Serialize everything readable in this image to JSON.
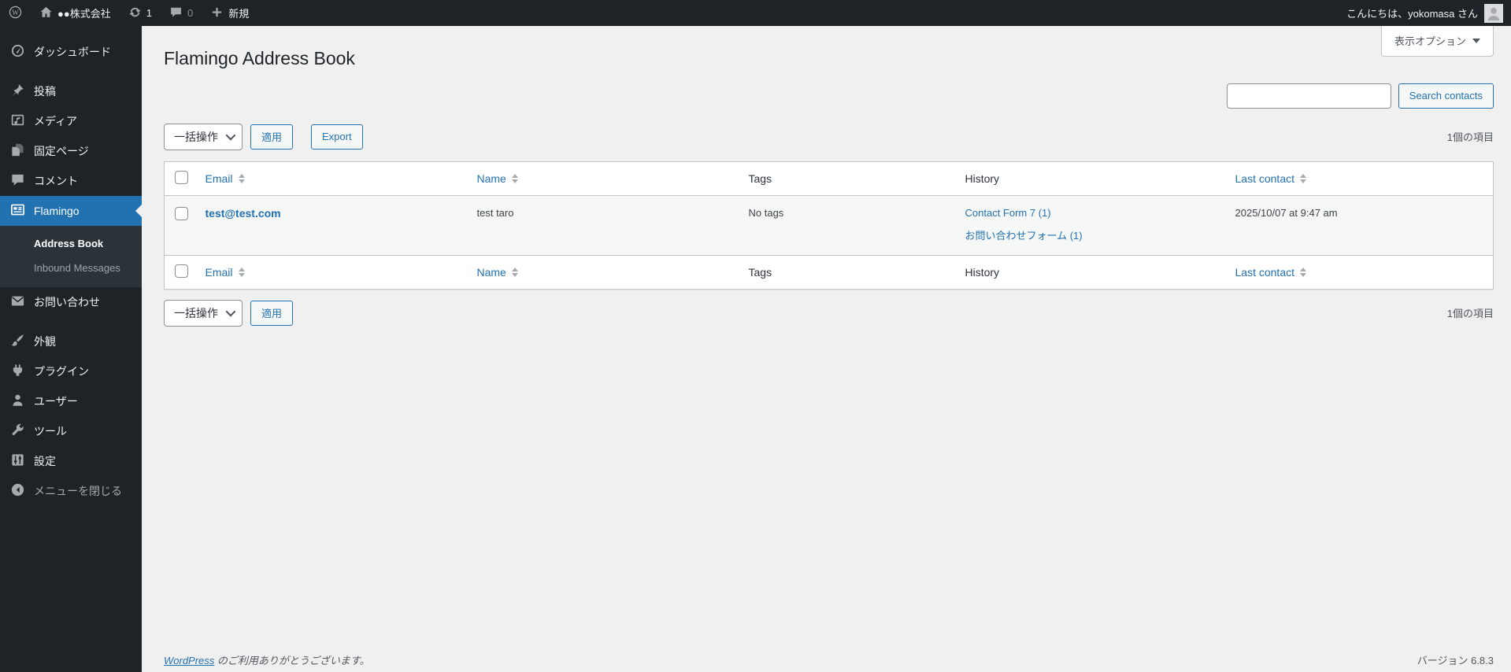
{
  "admin_bar": {
    "site_name": "●●株式会社",
    "update_count": "1",
    "comment_count": "0",
    "new_label": "新規",
    "greeting": "こんにちは、yokomasa さん"
  },
  "sidebar": {
    "items": [
      {
        "label": "ダッシュボード",
        "icon": "gauge-icon"
      },
      {
        "label": "投稿",
        "icon": "pushpin-icon"
      },
      {
        "label": "メディア",
        "icon": "media-icon"
      },
      {
        "label": "固定ページ",
        "icon": "pages-icon"
      },
      {
        "label": "コメント",
        "icon": "comment-icon"
      },
      {
        "label": "Flamingo",
        "icon": "address-card-icon",
        "active": true
      },
      {
        "label": "お問い合わせ",
        "icon": "envelope-icon"
      },
      {
        "label": "外観",
        "icon": "brush-icon"
      },
      {
        "label": "プラグイン",
        "icon": "plug-icon"
      },
      {
        "label": "ユーザー",
        "icon": "user-icon"
      },
      {
        "label": "ツール",
        "icon": "wrench-icon"
      },
      {
        "label": "設定",
        "icon": "sliders-icon"
      }
    ],
    "flamingo_submenu": [
      {
        "label": "Address Book",
        "active": true
      },
      {
        "label": "Inbound Messages",
        "active": false
      }
    ],
    "collapse_label": "メニューを閉じる"
  },
  "page": {
    "title": "Flamingo Address Book",
    "screen_options_label": "表示オプション",
    "search_value": "",
    "search_button": "Search contacts",
    "bulk_action_label": "一括操作",
    "apply_button": "適用",
    "export_button": "Export",
    "item_count": "1個の項目"
  },
  "table": {
    "columns": [
      {
        "label": "Email",
        "sortable": true
      },
      {
        "label": "Name",
        "sortable": true
      },
      {
        "label": "Tags",
        "sortable": false
      },
      {
        "label": "History",
        "sortable": false
      },
      {
        "label": "Last contact",
        "sortable": true
      }
    ],
    "rows": [
      {
        "email": "test@test.com",
        "name": "test taro",
        "tags": "No tags",
        "history": [
          "Contact Form 7 (1)",
          "お問い合わせフォーム (1)"
        ],
        "last_contact": "2025/10/07 at 9:47 am"
      }
    ]
  },
  "footer": {
    "thanks_link": "WordPress",
    "thanks_rest": " のご利用ありがとうございます。",
    "version": "バージョン 6.8.3"
  },
  "icons": {
    "wp-logo-icon": "W in circle",
    "home-icon": "house",
    "update-icon": "circular arrows",
    "comment-icon": "speech bubble",
    "plus-icon": "+",
    "avatar-icon": "person silhouette",
    "chevron-down-icon": "▼",
    "sort-icon": "▲▼",
    "collapse-icon": "◀ in circle"
  },
  "colors": {
    "accent_blue": "#2271b1",
    "admin_dark": "#1d2327",
    "submenu_dark": "#2c3338",
    "content_bg": "#f0f0f1",
    "border_gray": "#c3c4c7",
    "row_stripe": "#f6f7f7"
  }
}
